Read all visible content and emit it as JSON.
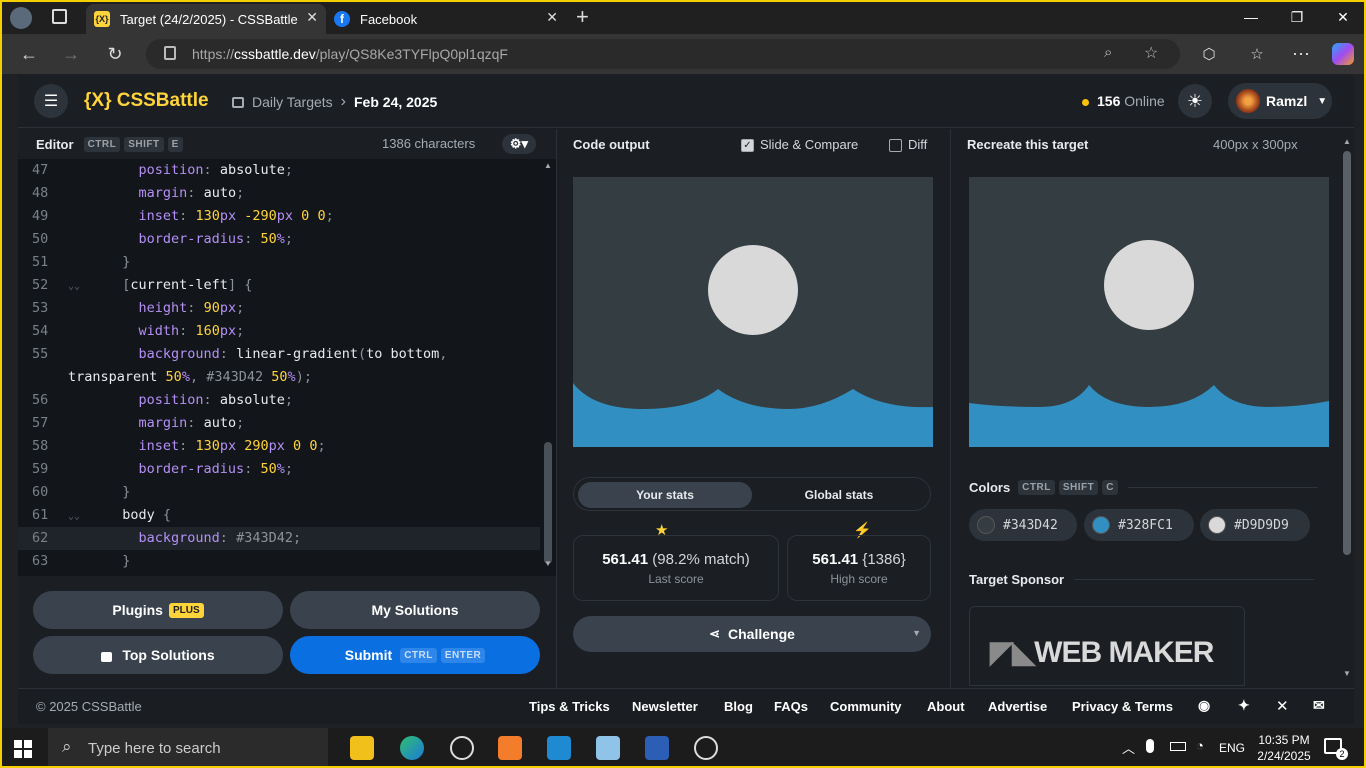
{
  "browser": {
    "tabs": [
      {
        "title": "Target (24/2/2025) - CSSBattle",
        "favicon": "{X}"
      },
      {
        "title": "Facebook",
        "favicon": "f"
      }
    ],
    "url_prefix": "https://",
    "url_domain": "cssbattle.dev",
    "url_path": "/play/QS8Ke3TYFlpQ0pl1qzqF"
  },
  "header": {
    "logo": "{X} CSSBattle",
    "crumb_parent": "Daily Targets",
    "crumb_current": "Feb 24, 2025",
    "online_count": "156",
    "online_label": "Online",
    "user_name": "Ramzl"
  },
  "editor": {
    "title": "Editor",
    "shortcut": [
      "CTRL",
      "SHIFT",
      "E"
    ],
    "char_count": "1386 characters",
    "lines": [
      {
        "n": "47",
        "text": "    position: absolute;"
      },
      {
        "n": "48",
        "text": "    margin: auto;"
      },
      {
        "n": "49",
        "text": "    inset: 130px -290px 0 0;"
      },
      {
        "n": "50",
        "text": "    border-radius: 50%;"
      },
      {
        "n": "51",
        "text": "  }"
      },
      {
        "n": "52",
        "text": "  [current-left] {",
        "fold": true
      },
      {
        "n": "53",
        "text": "    height: 90px;"
      },
      {
        "n": "54",
        "text": "    width: 160px;"
      },
      {
        "n": "55",
        "text": "    background: linear-gradient(to bottom,"
      },
      {
        "n": "",
        "text": "transparent 50%, #343D42 50%);"
      },
      {
        "n": "56",
        "text": "    position: absolute;"
      },
      {
        "n": "57",
        "text": "    margin: auto;"
      },
      {
        "n": "58",
        "text": "    inset: 130px 290px 0 0;"
      },
      {
        "n": "59",
        "text": "    border-radius: 50%;"
      },
      {
        "n": "60",
        "text": "  }"
      },
      {
        "n": "61",
        "text": "  body {",
        "fold": true
      },
      {
        "n": "62",
        "text": "    background: #343D42;",
        "active": true
      },
      {
        "n": "63",
        "text": "  }"
      }
    ],
    "buttons": {
      "plugins": "Plugins",
      "plugins_badge": "PLUS",
      "my_solutions": "My Solutions",
      "top_solutions": "Top Solutions",
      "submit": "Submit",
      "submit_keys": [
        "CTRL",
        "ENTER"
      ]
    }
  },
  "output": {
    "title": "Code output",
    "slide_compare": "Slide & Compare",
    "slide_compare_checked": true,
    "diff": "Diff",
    "diff_checked": false,
    "tab_your": "Your stats",
    "tab_global": "Global stats",
    "last_score": "561.41",
    "last_match": "(98.2% match)",
    "last_label": "Last score",
    "high_score": "561.41",
    "high_chars": "{1386}",
    "high_label": "High score",
    "challenge": "Challenge"
  },
  "target": {
    "title": "Recreate this target",
    "size": "400px x 300px",
    "colors_label": "Colors",
    "colors_keys": [
      "CTRL",
      "SHIFT",
      "C"
    ],
    "colors": [
      {
        "hex": "#343D42"
      },
      {
        "hex": "#328FC1"
      },
      {
        "hex": "#D9D9D9"
      }
    ],
    "sponsor_label": "Target Sponsor",
    "sponsor_name": "WEB MAKER"
  },
  "footer": {
    "copyright": "© 2025 CSSBattle",
    "links": [
      "Tips & Tricks",
      "Newsletter",
      "Blog",
      "FAQs",
      "Community",
      "About",
      "Advertise",
      "Privacy & Terms"
    ]
  },
  "taskbar": {
    "search_placeholder": "Type here to search",
    "lang": "ENG",
    "time": "10:35 PM",
    "date": "2/24/2025",
    "notif_count": "2"
  }
}
